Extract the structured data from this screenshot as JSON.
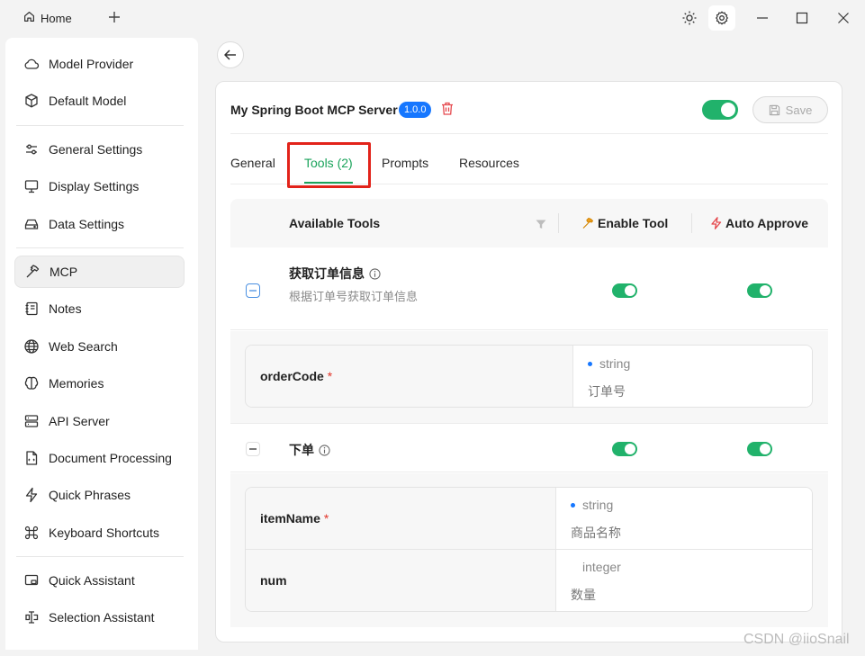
{
  "titlebar": {
    "home_label": "Home"
  },
  "sidebar": {
    "items": [
      {
        "label": "Model Provider",
        "icon": "cloud-icon"
      },
      {
        "label": "Default Model",
        "icon": "cube-icon"
      },
      {
        "label": "General Settings",
        "icon": "sliders-icon"
      },
      {
        "label": "Display Settings",
        "icon": "monitor-icon"
      },
      {
        "label": "Data Settings",
        "icon": "drive-icon"
      },
      {
        "label": "MCP",
        "icon": "hammer-icon",
        "active": true
      },
      {
        "label": "Notes",
        "icon": "notebook-icon"
      },
      {
        "label": "Web Search",
        "icon": "globe-icon"
      },
      {
        "label": "Memories",
        "icon": "brain-icon"
      },
      {
        "label": "API Server",
        "icon": "server-icon"
      },
      {
        "label": "Document Processing",
        "icon": "document-icon"
      },
      {
        "label": "Quick Phrases",
        "icon": "zap-icon"
      },
      {
        "label": "Keyboard Shortcuts",
        "icon": "command-icon"
      },
      {
        "label": "Quick Assistant",
        "icon": "window-icon"
      },
      {
        "label": "Selection Assistant",
        "icon": "text-cursor-icon"
      }
    ]
  },
  "server": {
    "name": "My Spring Boot MCP Server",
    "version": "1.0.0",
    "enabled": true,
    "save_label": "Save"
  },
  "tabs": [
    {
      "label": "General"
    },
    {
      "label": "Tools (2)",
      "active": true
    },
    {
      "label": "Prompts"
    },
    {
      "label": "Resources"
    }
  ],
  "table": {
    "col_tools": "Available Tools",
    "col_enable": "Enable Tool",
    "col_approve": "Auto Approve"
  },
  "tools": [
    {
      "name": "获取订单信息",
      "description": "根据订单号获取订单信息",
      "enabled": true,
      "auto_approve": true,
      "params": [
        {
          "key": "orderCode",
          "required": "*",
          "type": "string",
          "description": "订单号"
        }
      ]
    },
    {
      "name": "下单",
      "description": "",
      "enabled": true,
      "auto_approve": true,
      "params": [
        {
          "key": "itemName",
          "required": "*",
          "type": "string",
          "description": "商品名称"
        },
        {
          "key": "num",
          "required": "",
          "type": "integer",
          "description": "数量"
        }
      ]
    }
  ],
  "watermark": "CSDN @iioSnail",
  "colors": {
    "accent": "#1aa35b",
    "toggle_on": "#21b26b",
    "badge": "#1677ff",
    "highlight_box": "#e2231a"
  }
}
